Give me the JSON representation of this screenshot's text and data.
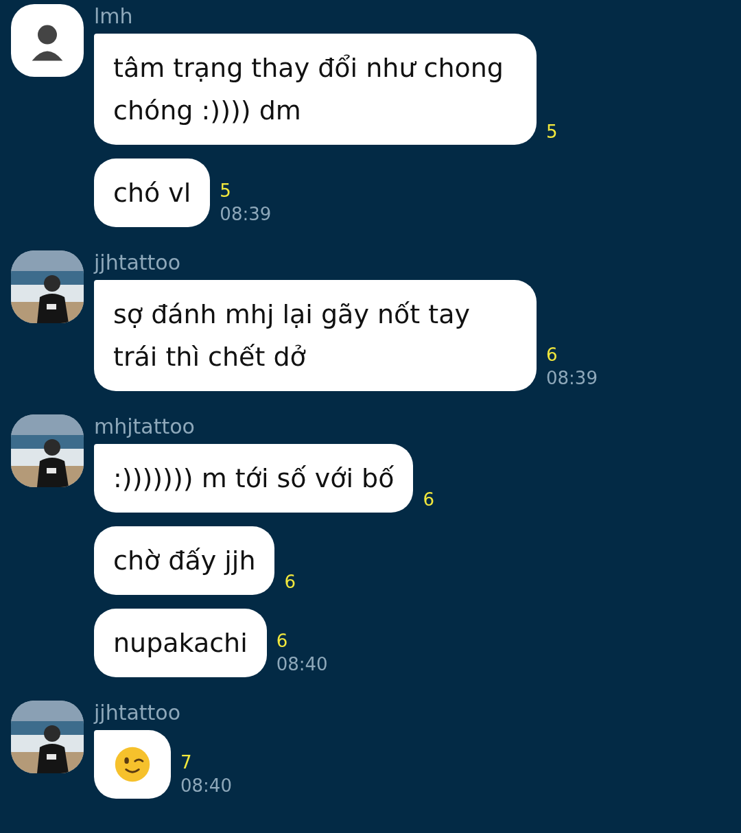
{
  "messages_groups": [
    {
      "sender": "lmh",
      "avatar": {
        "kind": "cartoon"
      },
      "messages": [
        {
          "kind": "text",
          "text": "tâm trạng thay đổi như chong chóng :)))) dm",
          "read_count": "5"
        },
        {
          "kind": "text",
          "text": "chó vl",
          "read_count": "5",
          "time": "08:39"
        }
      ]
    },
    {
      "sender": "jjhtattoo",
      "avatar": {
        "kind": "picture"
      },
      "messages": [
        {
          "kind": "text",
          "text": "sợ đánh mhj lại gãy nốt tay trái thì chết dở",
          "read_count": "6",
          "time": "08:39"
        }
      ]
    },
    {
      "sender": "mhjtattoo",
      "avatar": {
        "kind": "picture"
      },
      "messages": [
        {
          "kind": "text",
          "text": ":))))))) m tới số với bố",
          "read_count": "6"
        },
        {
          "kind": "text",
          "text": "chờ đấy jjh",
          "read_count": "6"
        },
        {
          "kind": "text",
          "text": "nupakachi",
          "read_count": "6",
          "time": "08:40"
        }
      ]
    },
    {
      "sender": "jjhtattoo",
      "avatar": {
        "kind": "picture"
      },
      "messages": [
        {
          "kind": "emoji",
          "read_count": "7",
          "time": "08:40"
        }
      ]
    }
  ]
}
